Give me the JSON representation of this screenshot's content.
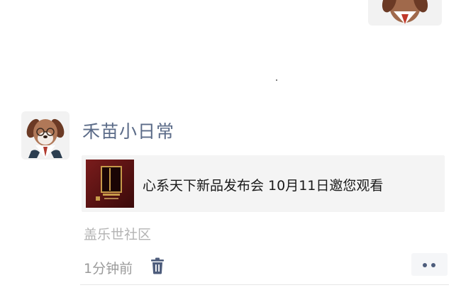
{
  "post": {
    "author": "禾苗小日常",
    "share_title": "心系天下新品发布会 10月11日邀您观看",
    "location": "盖乐世社区",
    "time": "1分钟前"
  },
  "icons": {
    "avatar": "dog-avatar-icon",
    "delete": "trash-icon",
    "more": "more-dots-icon"
  },
  "colors": {
    "nickname": "#5b6b88",
    "accent": "#4e5d7c",
    "card_bg": "#f4f4f4"
  }
}
